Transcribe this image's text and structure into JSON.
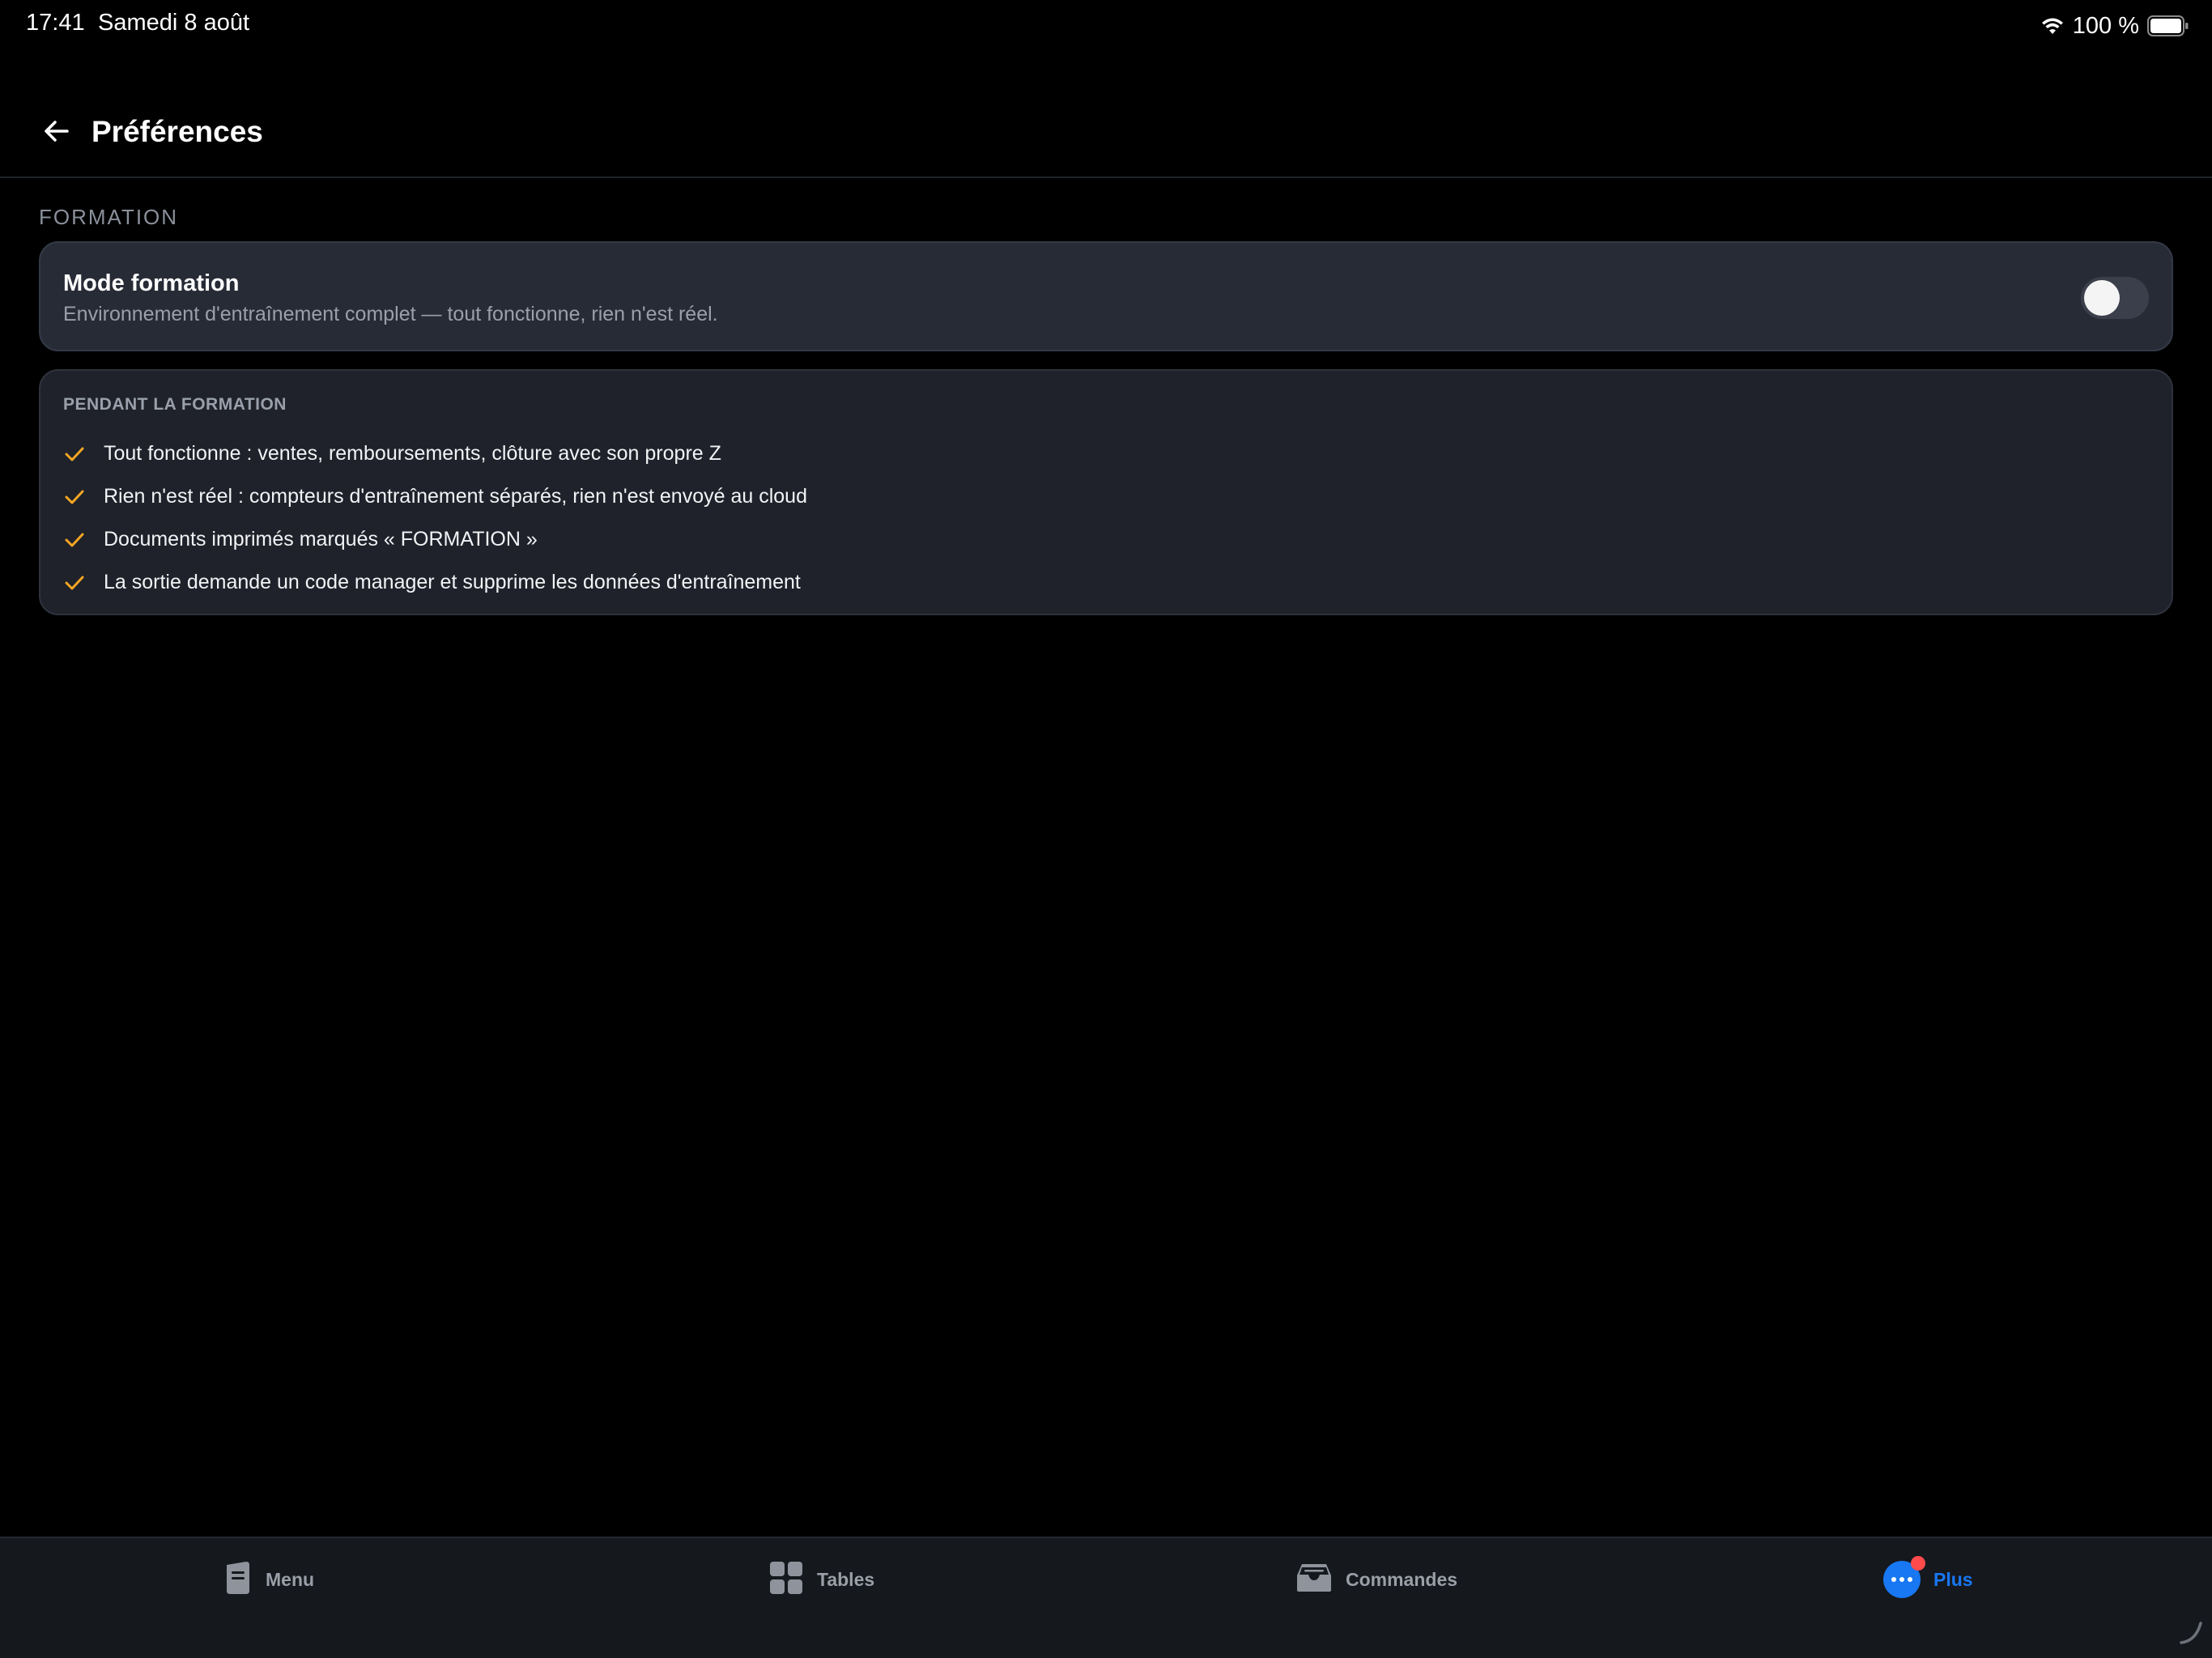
{
  "status_bar": {
    "time": "17:41",
    "date": "Samedi 8 août",
    "battery": "100 %"
  },
  "header": {
    "title": "Préférences"
  },
  "section": {
    "label": "FORMATION"
  },
  "mode_card": {
    "title": "Mode formation",
    "description": "Environnement d'entraînement complet — tout fonctionne, rien n'est réel.",
    "toggle_on": false
  },
  "info_card": {
    "heading": "PENDANT LA FORMATION",
    "items": [
      "Tout fonctionne : ventes, remboursements, clôture avec son propre Z",
      "Rien n'est réel : compteurs d'entraînement séparés, rien n'est envoyé au cloud",
      "Documents imprimés marqués « FORMATION »",
      "La sortie demande un code manager et supprime les données d'entraînement"
    ]
  },
  "tab_bar": {
    "tabs": [
      {
        "label": "Menu",
        "icon": "menu-document-icon",
        "active": false
      },
      {
        "label": "Tables",
        "icon": "grid-icon",
        "active": false
      },
      {
        "label": "Commandes",
        "icon": "inbox-icon",
        "active": false
      },
      {
        "label": "Plus",
        "icon": "more-dots-icon",
        "active": true,
        "badge": true
      }
    ]
  },
  "colors": {
    "accent": "#1877f2",
    "check": "#f5a623",
    "badge": "#ff4b4b",
    "card_bg": "#272b36"
  }
}
